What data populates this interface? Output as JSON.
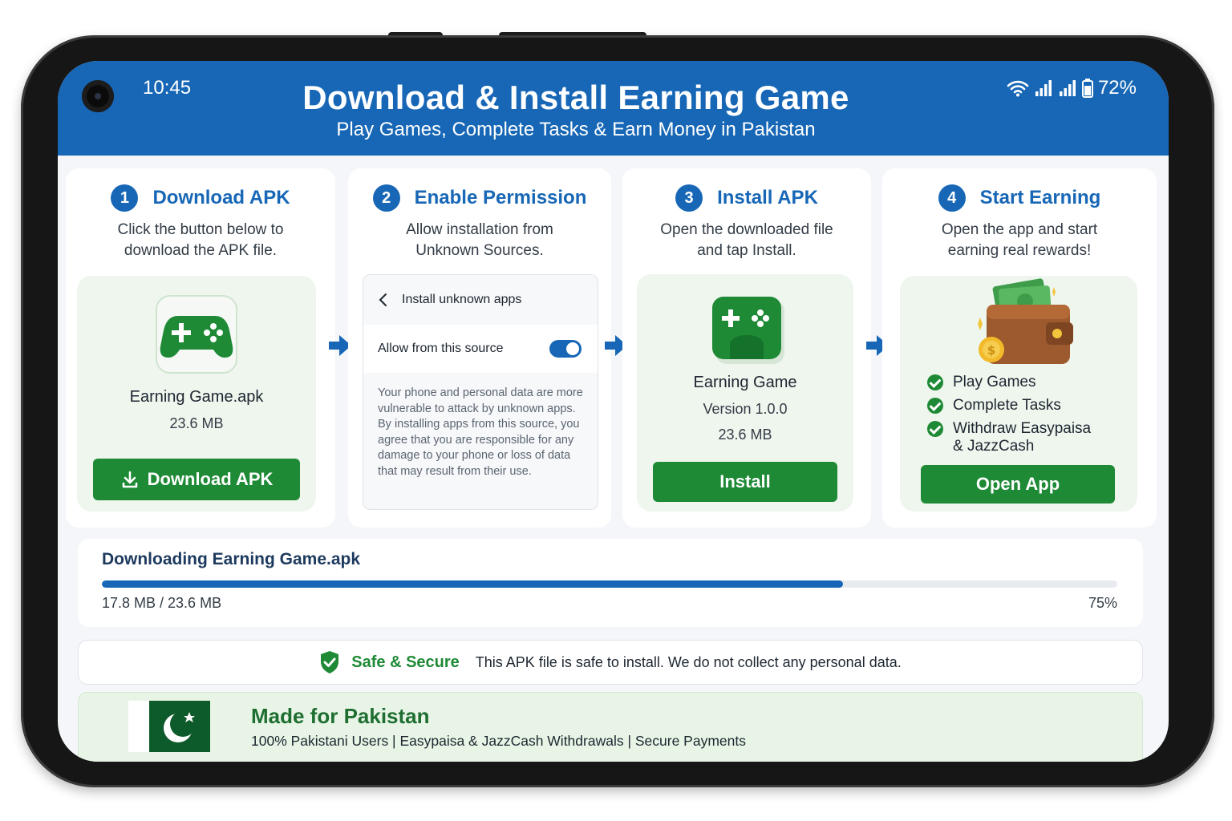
{
  "status_bar": {
    "time": "10:45",
    "battery": "72%"
  },
  "header": {
    "title": "Download & Install Earning Game",
    "subtitle": "Play Games, Complete Tasks & Earn Money in Pakistan"
  },
  "steps": [
    {
      "number": "1",
      "title": "Download APK",
      "desc_line1": "Click the button below to",
      "desc_line2": "download the APK file.",
      "file_name": "Earning Game.apk",
      "file_size": "23.6 MB",
      "button_label": "Download APK"
    },
    {
      "number": "2",
      "title": "Enable Permission",
      "desc_line1": "Allow installation from",
      "desc_line2": "Unknown Sources.",
      "dialog_title": "Install unknown apps",
      "toggle_label": "Allow from this source",
      "warning": "Your phone and personal data are more vulnerable to attack by unknown apps. By installing apps from this source, you agree that you are responsible for any damage to your phone or loss of data that may result from their use."
    },
    {
      "number": "3",
      "title": "Install APK",
      "desc_line1": "Open the downloaded file",
      "desc_line2": "and tap Install.",
      "app_name": "Earning Game",
      "version": "Version 1.0.0",
      "app_size": "23.6 MB",
      "button_label": "Install"
    },
    {
      "number": "4",
      "title": "Start Earning",
      "desc_line1": "Open the app and start",
      "desc_line2": "earning real rewards!",
      "features": [
        "Play Games",
        "Complete Tasks",
        "Withdraw Easypaisa",
        "& JazzCash"
      ],
      "button_label": "Open App"
    }
  ],
  "download": {
    "title": "Downloading Earning Game.apk",
    "size_text": "17.8 MB / 23.6 MB",
    "percent_text": "75%",
    "progress": 0.73
  },
  "safety": {
    "title": "Safe & Secure",
    "text": "This APK file is safe to install. We do not collect any personal data."
  },
  "pakistan": {
    "title": "Made for Pakistan",
    "text": "100% Pakistani Users | Easypaisa & JazzCash Withdrawals | Secure Payments"
  },
  "colors": {
    "primary_blue": "#1767b6",
    "accent_green": "#1e8a35",
    "flag_green": "#0d5a2a"
  }
}
